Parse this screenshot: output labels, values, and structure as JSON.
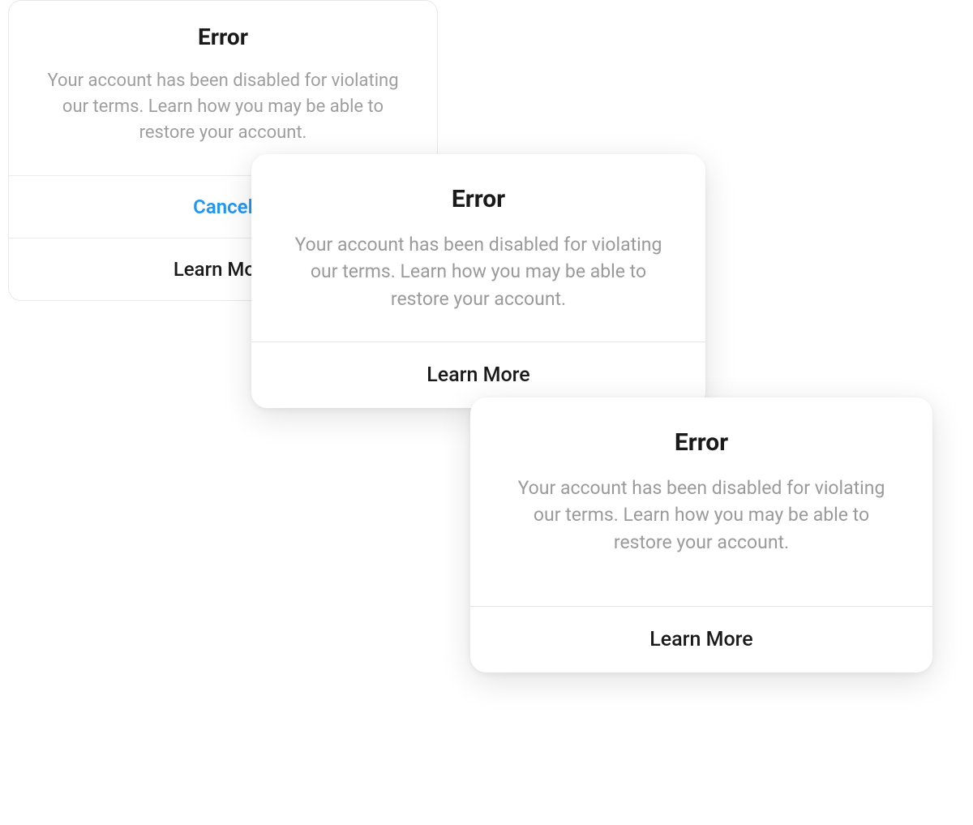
{
  "dialogs": [
    {
      "title": "Error",
      "message": "Your account has been disabled for violating our terms. Learn how you may be able to restore your account.",
      "buttons": [
        {
          "label": "Cancel",
          "primary": true
        },
        {
          "label": "Learn More",
          "primary": false
        }
      ]
    },
    {
      "title": "Error",
      "message": "Your account has been disabled for violating our terms. Learn how you may be able to restore your account.",
      "buttons": [
        {
          "label": "Learn More",
          "primary": false
        }
      ]
    },
    {
      "title": "Error",
      "message": "Your account has been disabled for violating our terms. Learn how you may be able to restore your account.",
      "buttons": [
        {
          "label": "Learn More",
          "primary": false
        }
      ]
    }
  ]
}
